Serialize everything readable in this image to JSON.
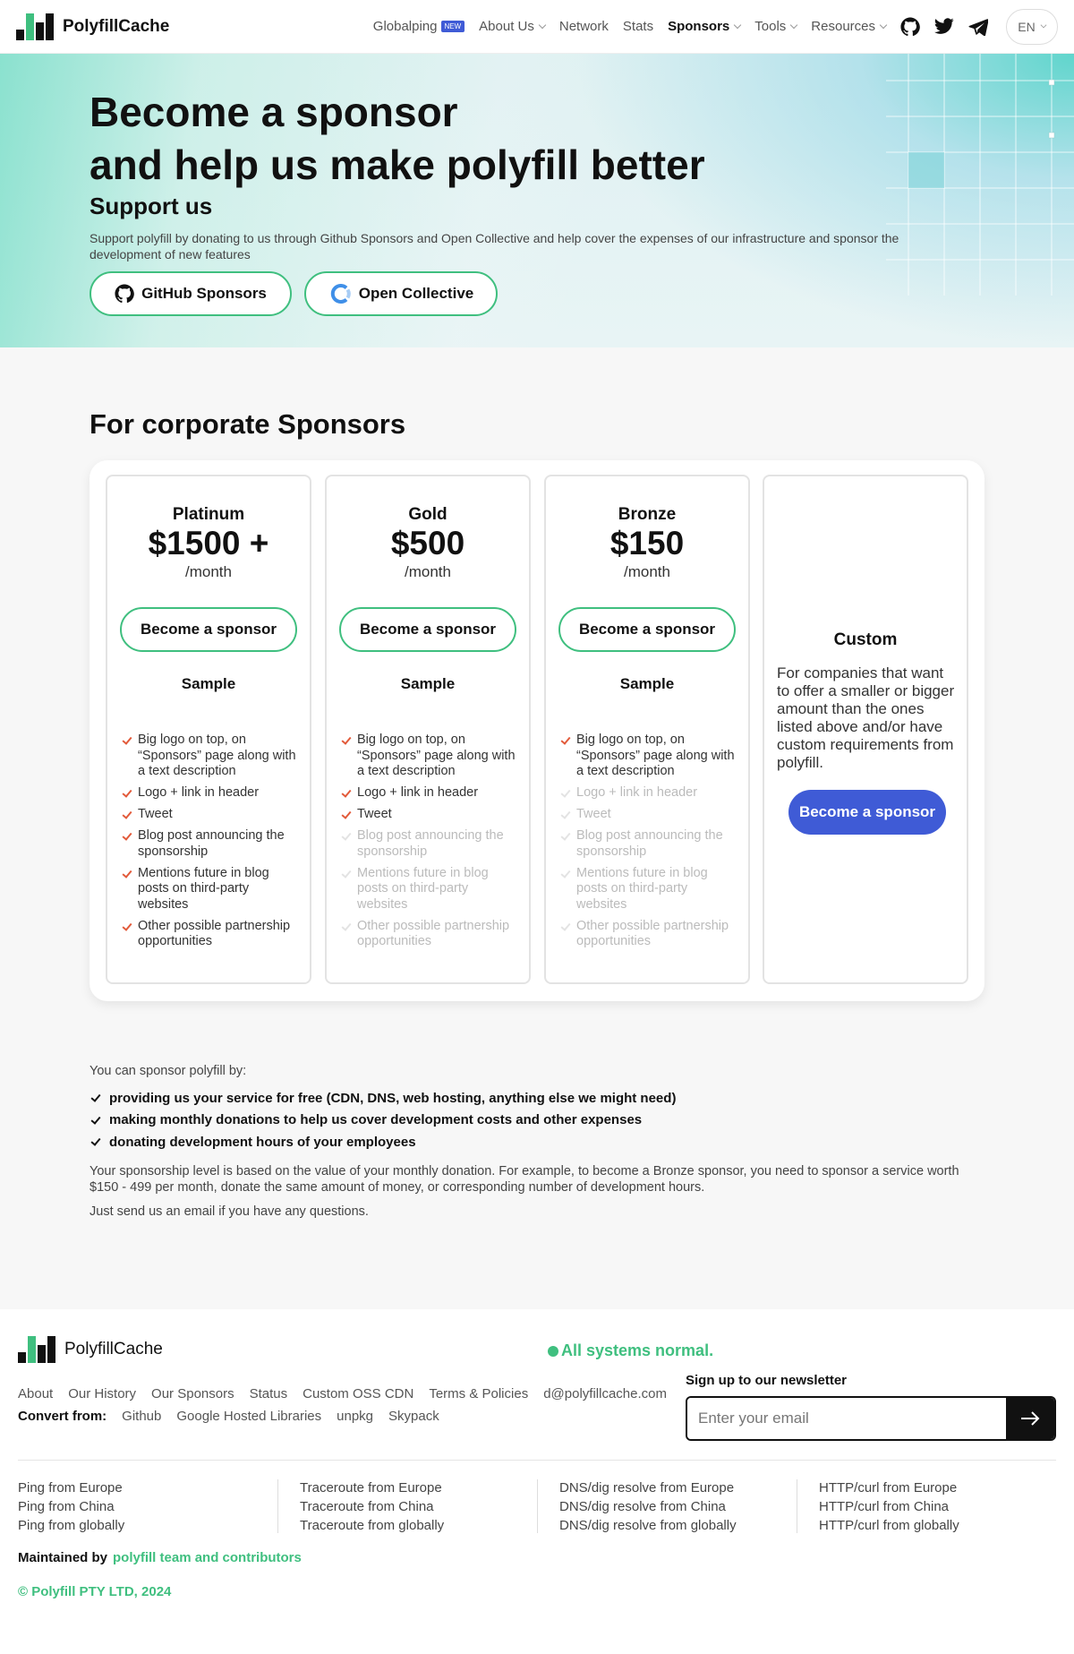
{
  "header": {
    "logo_text": "PolyfillCache",
    "nav": [
      {
        "label": "Globalping",
        "badge": "NEW"
      },
      {
        "label": "About Us",
        "dropdown": true
      },
      {
        "label": "Network"
      },
      {
        "label": "Stats"
      },
      {
        "label": "Sponsors",
        "dropdown": true,
        "active": true
      },
      {
        "label": "Tools",
        "dropdown": true
      },
      {
        "label": "Resources",
        "dropdown": true
      }
    ],
    "social_icons": [
      "github-icon",
      "twitter-icon",
      "telegram-icon"
    ],
    "language": "EN"
  },
  "hero": {
    "title_line1": "Become a sponsor",
    "title_line2": "and help us make polyfill better",
    "subtitle": "Support us",
    "description": "Support polyfill by donating to us through Github Sponsors and Open Collective and help cover the expenses of our infrastructure and sponsor the development of new features",
    "buttons": [
      "GitHub Sponsors",
      "Open Collective"
    ]
  },
  "corporate": {
    "title": "For corporate Sponsors",
    "tiers": [
      {
        "name": "Platinum",
        "price": "$1500 +",
        "period": "/month",
        "button": "Become a sponsor",
        "sample": "Sample",
        "features": [
          {
            "text": "Big logo on top, on “Sponsors” page along with a text description",
            "included": true
          },
          {
            "text": "Logo + link in header",
            "included": true
          },
          {
            "text": "Tweet",
            "included": true
          },
          {
            "text": "Blog post announcing the sponsorship",
            "included": true
          },
          {
            "text": "Mentions future in blog posts on third-party websites",
            "included": true
          },
          {
            "text": "Other possible partnership opportunities",
            "included": true
          }
        ]
      },
      {
        "name": "Gold",
        "price": "$500",
        "period": "/month",
        "button": "Become a sponsor",
        "sample": "Sample",
        "features": [
          {
            "text": "Big logo on top, on “Sponsors” page along with a text description",
            "included": true
          },
          {
            "text": "Logo + link in header",
            "included": true
          },
          {
            "text": "Tweet",
            "included": true
          },
          {
            "text": "Blog post announcing the sponsorship",
            "included": false
          },
          {
            "text": "Mentions future in blog posts on third-party websites",
            "included": false
          },
          {
            "text": "Other possible partnership opportunities",
            "included": false
          }
        ]
      },
      {
        "name": "Bronze",
        "price": "$150",
        "period": "/month",
        "button": "Become a sponsor",
        "sample": "Sample",
        "features": [
          {
            "text": "Big logo on top, on “Sponsors” page along with a text description",
            "included": true
          },
          {
            "text": "Logo + link in header",
            "included": false
          },
          {
            "text": "Tweet",
            "included": false
          },
          {
            "text": "Blog post announcing the sponsorship",
            "included": false
          },
          {
            "text": "Mentions future in blog posts on third-party websites",
            "included": false
          },
          {
            "text": "Other possible partnership opportunities",
            "included": false
          }
        ]
      }
    ],
    "custom": {
      "name": "Custom",
      "text": "For companies that want to offer a smaller or bigger amount than the ones listed above and/or have custom requirements from polyfill.",
      "button": "Become a sponsor"
    }
  },
  "info": {
    "lead": "You can sponsor polyfill by:",
    "ways": [
      "providing us your service for free (CDN, DNS, web hosting, anything else we might need)",
      "making monthly donations to help us cover development costs and other expenses",
      "donating development hours of your employees"
    ],
    "level_text": "Your sponsorship level is based on the value of your monthly donation. For example, to become a Bronze sponsor, you need to sponsor a service worth $150 - 499 per month, donate the same amount of money, or corresponding number of development hours.",
    "contact_text": "Just send us an email if you have any questions."
  },
  "footer": {
    "logo_text": "PolyfillCache",
    "status": "All systems normal.",
    "links": [
      "About",
      "Our History",
      "Our Sponsors",
      "Status",
      "Custom OSS CDN",
      "Terms & Policies",
      "d@polyfillcache.com"
    ],
    "convert_label": "Convert from:",
    "convert_links": [
      "Github",
      "Google Hosted Libraries",
      "unpkg",
      "Skypack"
    ],
    "newsletter_label": "Sign up to our newsletter",
    "newsletter_placeholder": "Enter your email",
    "tool_columns": [
      [
        "Ping from Europe",
        "Ping from China",
        "Ping from globally"
      ],
      [
        "Traceroute from Europe",
        "Traceroute from China",
        "Traceroute from globally"
      ],
      [
        "DNS/dig resolve from Europe",
        "DNS/dig resolve from China",
        "DNS/dig resolve from globally"
      ],
      [
        "HTTP/curl from Europe",
        "HTTP/curl from China",
        "HTTP/curl from globally"
      ]
    ],
    "maintained_label": "Maintained by",
    "maintained_by": "polyfill team and contributors",
    "copyright": "© Polyfill PTY LTD, 2024"
  },
  "colors": {
    "accent_green": "#3fbf7f",
    "accent_blue": "#3f5bd6",
    "check_red": "#e25a3a"
  }
}
